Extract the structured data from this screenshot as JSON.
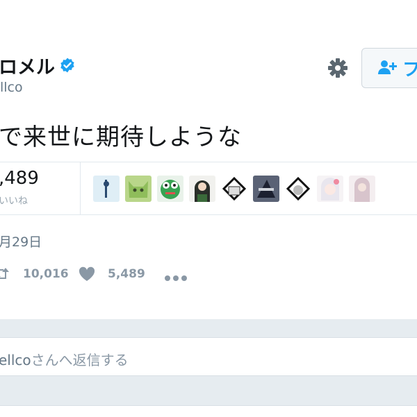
{
  "tweet": {
    "display_name": "ロメル",
    "handle": "llco",
    "text": "で来世に期待しような",
    "likes_count": ",489",
    "likes_label": "いいね",
    "timestamp": "月29日",
    "retweet_count": "10,016",
    "like_count": "5,489"
  },
  "header": {
    "follow_label": "フ"
  },
  "reply": {
    "handle": "ellco",
    "suffix": "さんへ返信する"
  },
  "colors": {
    "accent": "#1da1f2",
    "verified": "#1da1f2",
    "muted": "#8a98a5",
    "background": "#e6ecf0"
  },
  "icons": [
    "verified-badge-icon",
    "gear-icon",
    "follow-user-icon",
    "retweet-icon",
    "heart-icon",
    "more-icon"
  ]
}
